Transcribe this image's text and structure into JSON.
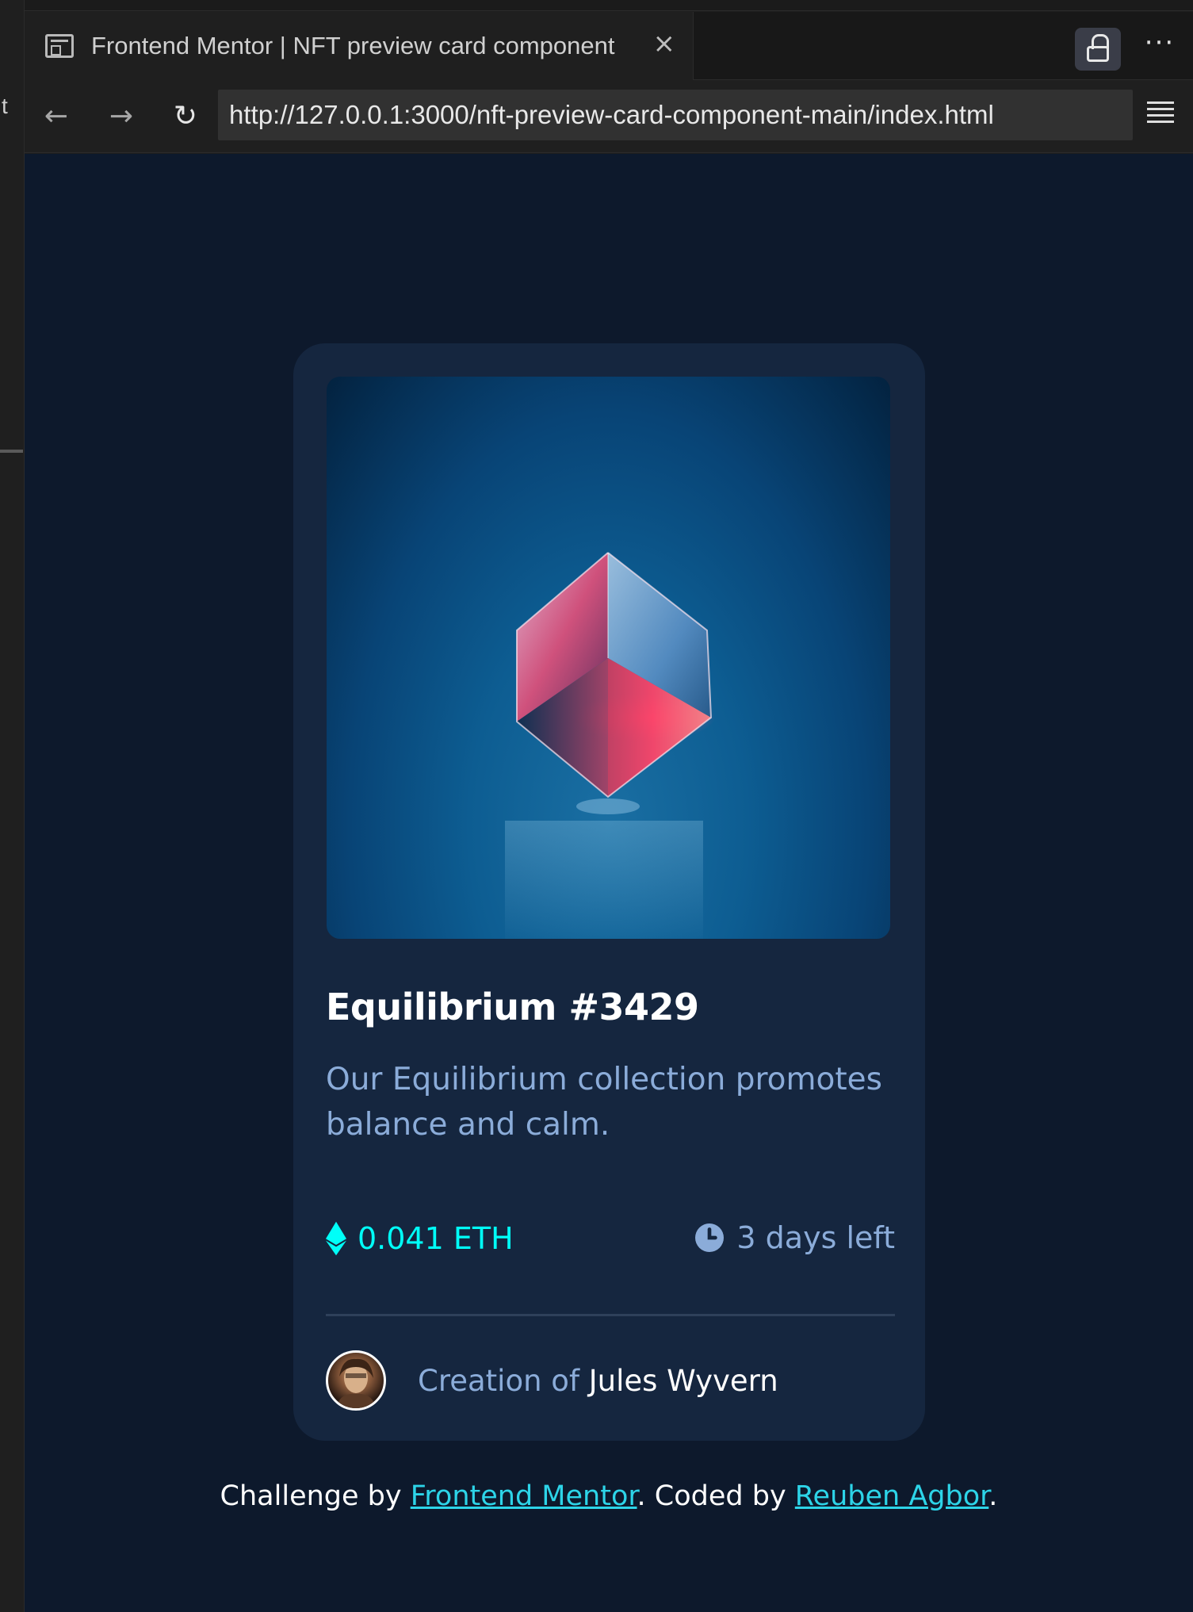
{
  "left_strip": {
    "edge_text": "t"
  },
  "tab": {
    "title": "Frontend Mentor | NFT preview card component",
    "close_glyph": "×",
    "icon": "preview-page-icon"
  },
  "toolbar": {
    "lock_icon": "lock-icon",
    "more_glyph": "···"
  },
  "navigation": {
    "back_glyph": "←",
    "forward_glyph": "→",
    "reload_glyph": "↻",
    "url": "http://127.0.0.1:3000/nft-preview-card-component-main/index.html",
    "menu_icon": "hamburger-icon"
  },
  "card": {
    "title": "Equilibrium #3429",
    "description": "Our Equilibrium collection promotes balance and calm.",
    "price": "0.041 ETH",
    "time_left": "3 days left",
    "creator_prefix": "Creation of ",
    "creator_name": "Jules Wyvern"
  },
  "attribution": {
    "challenge_prefix": "Challenge by ",
    "challenge_link": "Frontend Mentor",
    "middle": ". Coded by ",
    "author_link": "Reuben Agbor",
    "suffix": "."
  },
  "colors": {
    "page_bg": "#0d192c",
    "card_bg": "#15263f",
    "cyan": "#00fff8",
    "soft_blue": "#8bacd9",
    "divider": "#2e405a"
  }
}
